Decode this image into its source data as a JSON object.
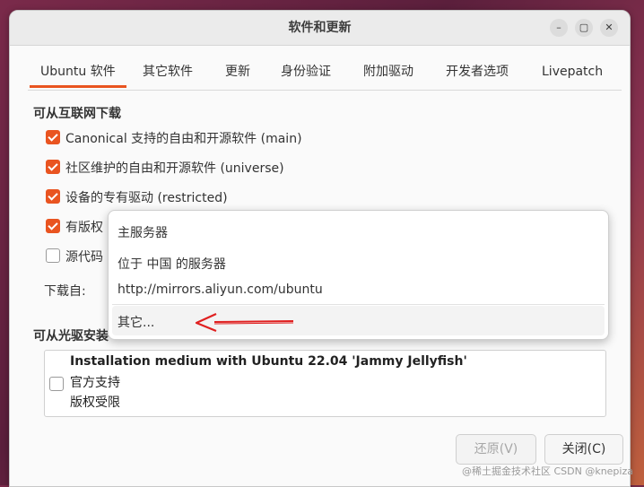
{
  "window": {
    "title": "软件和更新",
    "controls": {
      "minimize": "–",
      "maximize": "▢",
      "close": "✕"
    }
  },
  "tabs": [
    {
      "label": "Ubuntu 软件",
      "active": true
    },
    {
      "label": "其它软件"
    },
    {
      "label": "更新"
    },
    {
      "label": "身份验证"
    },
    {
      "label": "附加驱动"
    },
    {
      "label": "开发者选项"
    },
    {
      "label": "Livepatch"
    }
  ],
  "internet": {
    "section_title": "可从互联网下载",
    "options": [
      {
        "label": "Canonical 支持的自由和开源软件 (main)",
        "checked": true
      },
      {
        "label": "社区维护的自由和开源软件 (universe)",
        "checked": true
      },
      {
        "label": "设备的专有驱动 (restricted)",
        "checked": true
      },
      {
        "label": "有版权",
        "checked": true
      },
      {
        "label": "源代码",
        "checked": false
      }
    ],
    "download_from_label": "下载自:"
  },
  "popup": {
    "items": [
      {
        "label": "主服务器"
      },
      {
        "label": "位于 中国 的服务器"
      },
      {
        "label": "http://mirrors.aliyun.com/ubuntu"
      },
      {
        "label": "其它..."
      }
    ]
  },
  "cdrom": {
    "section_title": "可从光驱安装",
    "medium_title": "Installation medium with Ubuntu 22.04 'Jammy Jellyfish'",
    "lines": [
      "官方支持",
      "版权受限"
    ],
    "checked": false
  },
  "buttons": {
    "revert": "还原(V)",
    "close": "关闭(C)"
  },
  "watermark": "@稀土掘金技术社区 CSDN @knepiza",
  "colors": {
    "accent": "#e95420",
    "arrow": "#e02020"
  }
}
